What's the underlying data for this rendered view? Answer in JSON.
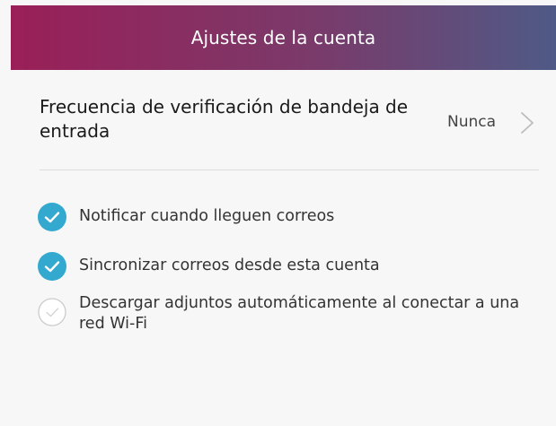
{
  "header": {
    "title": "Ajustes de la cuenta"
  },
  "inbox_check": {
    "label": "Frecuencia de verificación de bandeja de entrada",
    "value": "Nunca",
    "icon": "chevron-right-icon"
  },
  "options": [
    {
      "label": "Notificar cuando lleguen correos",
      "checked": true
    },
    {
      "label": "Sincronizar correos desde esta cuenta",
      "checked": true
    },
    {
      "label": "Descargar adjuntos automáticamente al conectar a una red Wi-Fi",
      "checked": false
    }
  ],
  "colors": {
    "header_gradient_start": "#9a1f58",
    "header_gradient_end": "#4f5a86",
    "check_on": "#33a9cf",
    "check_off_border": "#cccccc",
    "background": "#f7f7f7"
  }
}
